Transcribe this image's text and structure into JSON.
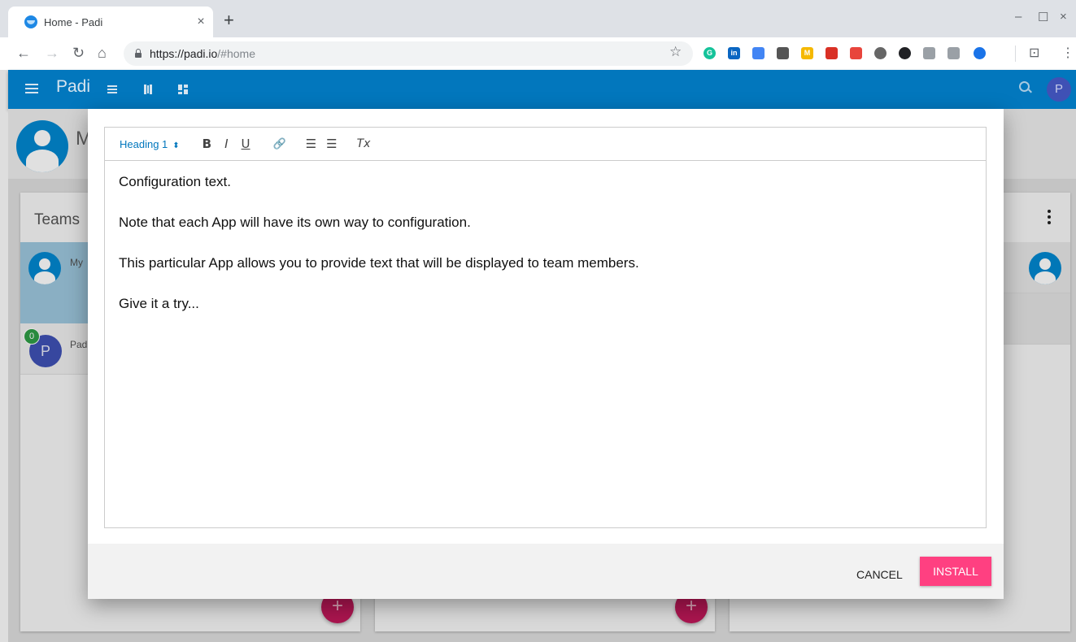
{
  "browser": {
    "tab_title": "Home - Padi",
    "tab_close": "×",
    "new_tab": "+",
    "url_host": "https://padi.io",
    "url_path": "/#home",
    "win_min": "–",
    "win_max": "☐",
    "win_close": "×",
    "extensions": [
      {
        "name": "grammarly-icon",
        "color": "#15c39a",
        "label": "G"
      },
      {
        "name": "linkedin-icon",
        "color": "#0a66c2",
        "label": "in"
      },
      {
        "name": "translate-icon",
        "color": "#4285f4",
        "label": ""
      },
      {
        "name": "spiral-icon",
        "color": "#555555",
        "label": ""
      },
      {
        "name": "m-icon",
        "color": "#f5b800",
        "label": "M"
      },
      {
        "name": "book-icon",
        "color": "#d93025",
        "label": ""
      },
      {
        "name": "percent-icon",
        "color": "#e8453c",
        "label": ""
      },
      {
        "name": "circle-icon",
        "color": "#666666",
        "label": ""
      },
      {
        "name": "dark-icon",
        "color": "#202124",
        "label": ""
      },
      {
        "name": "panel-icon",
        "color": "#9aa0a6",
        "label": ""
      },
      {
        "name": "puzzle-icon",
        "color": "#9aa0a6",
        "label": ""
      },
      {
        "name": "blue-circle-icon",
        "color": "#1a73e8",
        "label": ""
      }
    ]
  },
  "app": {
    "title": "Padi",
    "avatar_letter": "P"
  },
  "page": {
    "profile_initial": "M",
    "teams_title": "Teams",
    "team1_name": "My",
    "team2_letter": "P",
    "team2_badge": "0",
    "team2_name": "Pad",
    "fab_label": "+"
  },
  "dialog": {
    "heading_select": "Heading 1",
    "toolbar": {
      "bold": "B",
      "italic": "I",
      "underline": "U",
      "link": "🔗",
      "ordered_list": "☰",
      "bullet_list": "☰",
      "clear_format": "Tx"
    },
    "paragraphs": [
      "Configuration text.",
      "Note that each App will have its own way to configuration.",
      "This particular App allows you to provide text that will be displayed to team members.",
      "Give it a try..."
    ],
    "cancel_label": "CANCEL",
    "install_label": "INSTALL"
  }
}
